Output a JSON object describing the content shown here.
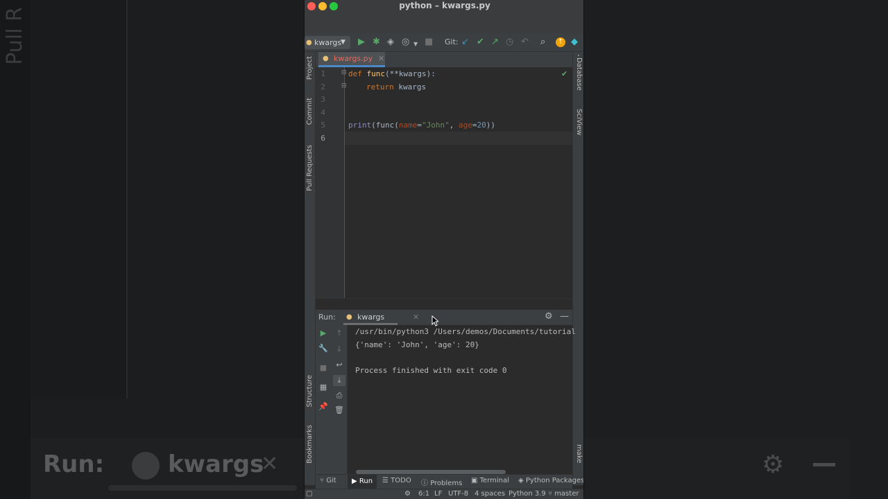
{
  "window": {
    "title": "python – kwargs.py"
  },
  "toolbar": {
    "run_config": "kwargs",
    "git_label": "Git:"
  },
  "editor": {
    "tab_name": "kwargs.py",
    "line_numbers": [
      "1",
      "2",
      "3",
      "4",
      "5",
      "6"
    ],
    "lines": {
      "l1": {
        "kw": "def",
        "fn": "func",
        "rest": "(**kwargs):"
      },
      "l2": {
        "kw": "return",
        "rest": " kwargs"
      },
      "l5": {
        "bi": "print",
        "p1": "(func(",
        "pa1": "name",
        "eq1": "=",
        "st": "\"John\"",
        "c": ", ",
        "pa2": "age",
        "eq2": "=",
        "nm": "20",
        "end": "))"
      }
    }
  },
  "left_strip": [
    "Project",
    "Commit",
    "Pull Requests",
    "Structure",
    "Bookmarks"
  ],
  "right_strip": [
    "Database",
    "SciView",
    "make"
  ],
  "run_panel": {
    "label": "Run:",
    "tab": "kwargs",
    "output": [
      "/usr/bin/python3 /Users/demos/Documents/tutorial",
      "{'name': 'John', 'age': 20}",
      "",
      "Process finished with exit code 0"
    ]
  },
  "bottom_tabs": [
    "Git",
    "Run",
    "TODO",
    "Problems",
    "Terminal",
    "Python Packages"
  ],
  "status_bar": {
    "position": "6:1",
    "line_sep": "LF",
    "encoding": "UTF-8",
    "indent": "4 spaces",
    "interpreter": "Python 3.9",
    "branch": "master"
  },
  "background": {
    "run_label": "Run:",
    "tab": "kwargs",
    "side_text": "Pull R"
  }
}
